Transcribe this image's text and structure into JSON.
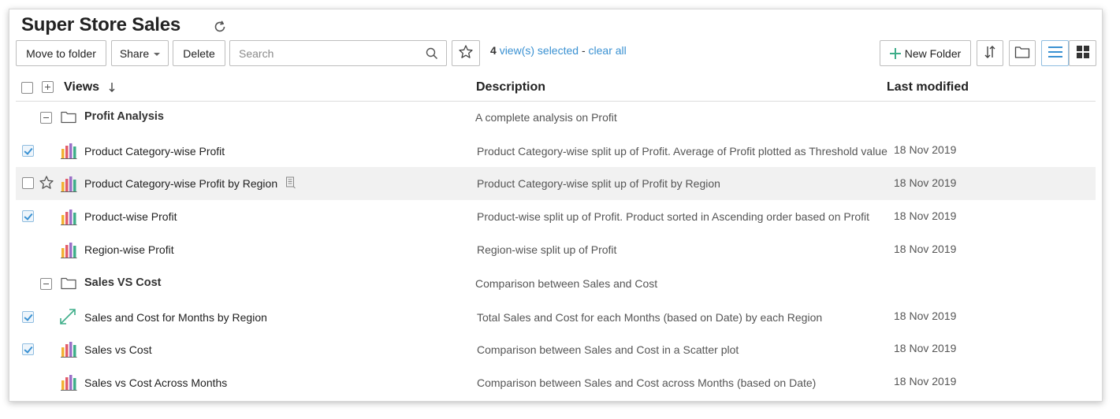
{
  "page": {
    "title": "Super Store Sales"
  },
  "toolbar": {
    "move_label": "Move to folder",
    "share_label": "Share",
    "delete_label": "Delete",
    "search_placeholder": "Search",
    "selection_count": "4",
    "selection_text": "view(s) selected",
    "separator": "-",
    "clear_label": "clear all",
    "new_folder_label": "New Folder",
    "accent_color": "#3a91d2"
  },
  "columns": {
    "views": "Views",
    "description": "Description",
    "last_modified": "Last modified"
  },
  "folders": [
    {
      "name": "Profit Analysis",
      "description": "A complete analysis on Profit"
    },
    {
      "name": "Sales VS Cost",
      "description": "Comparison between Sales and Cost"
    }
  ],
  "views": [
    {
      "name": "Product Category-wise Profit",
      "description": "Product Category-wise split up of Profit. Average of Profit plotted as Threshold value",
      "modified": "18 Nov 2019",
      "checked": true,
      "icon": "bar-chart-icon"
    },
    {
      "name": "Product Category-wise Profit by Region",
      "description": "Product Category-wise split up of Profit by Region",
      "modified": "18 Nov 2019",
      "checked": false,
      "icon": "bar-chart-icon"
    },
    {
      "name": "Product-wise Profit",
      "description": "Product-wise split up of Profit. Product sorted in Ascending order based on Profit",
      "modified": "18 Nov 2019",
      "checked": true,
      "icon": "bar-chart-icon"
    },
    {
      "name": "Region-wise Profit",
      "description": "Region-wise split up of Profit",
      "modified": "18 Nov 2019",
      "checked": false,
      "icon": "bar-chart-icon"
    },
    {
      "name": "Sales and Cost for Months by Region",
      "description": "Total Sales and Cost for each Months (based on Date) by each Region",
      "modified": "18 Nov 2019",
      "checked": true,
      "icon": "scatter-arrow-icon"
    },
    {
      "name": "Sales vs Cost",
      "description": "Comparison between Sales and Cost in a Scatter plot",
      "modified": "18 Nov 2019",
      "checked": true,
      "icon": "bar-chart-icon"
    },
    {
      "name": "Sales vs Cost Across Months",
      "description": "Comparison between Sales and Cost across Months (based on Date)",
      "modified": "18 Nov 2019",
      "checked": false,
      "icon": "bar-chart-icon"
    }
  ]
}
